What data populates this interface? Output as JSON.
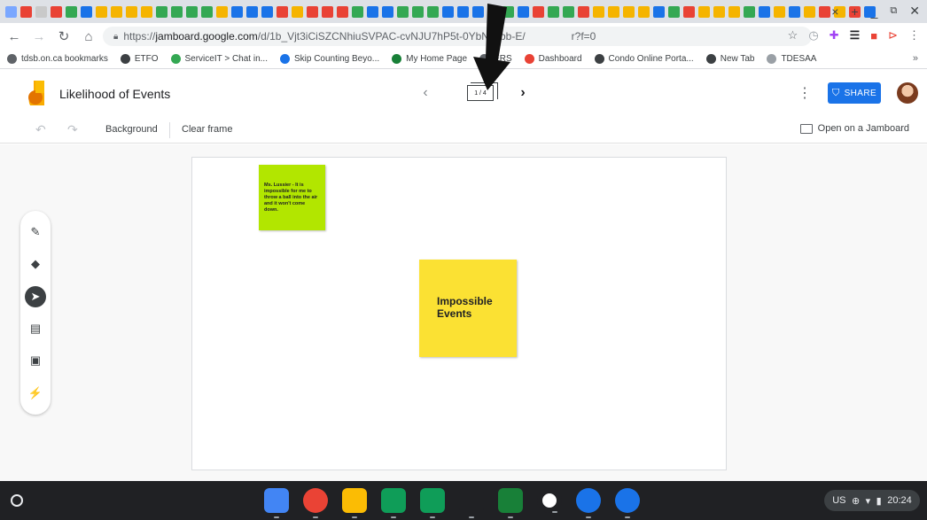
{
  "browser": {
    "url_prefix": "https://",
    "url_host": "jamboard.google.com",
    "url_path": "/d/1b_Vjt3iCiSZCNhiuSVPAC-cvNJU7hP5t-0YbNJvbb-E/",
    "url_tail": "r?f=0",
    "new_tab": "+",
    "tab_close": "×",
    "tab_favicon_colors": [
      "#7aa7ff",
      "#e94235",
      "#c9c9c9",
      "#e94235",
      "#34a853",
      "#1a73e8",
      "#f5b400",
      "#f5b400",
      "#f5b400",
      "#f5b400",
      "#34a853",
      "#34a853",
      "#34a853",
      "#34a853",
      "#f5b400",
      "#1a73e8",
      "#1a73e8",
      "#1a73e8",
      "#e94235",
      "#f5b400",
      "#e94235",
      "#e94235",
      "#e94235",
      "#34a853",
      "#1a73e8",
      "#1a73e8",
      "#34a853",
      "#34a853",
      "#34a853",
      "#1a73e8",
      "#1a73e8",
      "#1a73e8",
      "#1a73e8",
      "#34a853",
      "#1a73e8",
      "#e94235",
      "#34a853",
      "#34a853",
      "#e94235",
      "#f5b400",
      "#f5b400",
      "#f5b400",
      "#f5b400",
      "#1a73e8",
      "#34a853",
      "#e94235",
      "#f5b400",
      "#f5b400",
      "#f5b400",
      "#34a853",
      "#1a73e8",
      "#f5b400",
      "#1a73e8",
      "#f5b400",
      "#e94235",
      "#f5b400",
      "#e94235",
      "#1a73e8"
    ]
  },
  "bookmarks": [
    {
      "label": "tdsb.on.ca bookmarks",
      "color": "#5f6368"
    },
    {
      "label": "ETFO",
      "color": "#3c4043"
    },
    {
      "label": "ServiceIT > Chat in...",
      "color": "#34a853"
    },
    {
      "label": "Skip Counting Beyo...",
      "color": "#1a73e8"
    },
    {
      "label": "My Home Page",
      "color": "#188038"
    },
    {
      "label": "ERS",
      "color": "#5f6368"
    },
    {
      "label": "Dashboard",
      "color": "#e94235"
    },
    {
      "label": "Condo Online Porta...",
      "color": "#3c4043"
    },
    {
      "label": "New Tab",
      "color": "#3c4043"
    },
    {
      "label": "TDESAA",
      "color": "#9aa0a6"
    }
  ],
  "bookmarks_more": "»",
  "app": {
    "title": "Likelihood of Events",
    "frame_counter": "1 / 4",
    "share_label": "SHARE",
    "background_label": "Background",
    "clear_frame_label": "Clear frame",
    "open_jamboard_label": "Open on a Jamboard"
  },
  "stickies": {
    "green_text": "Ms. Lussier - It is impossible for me to throw a ball into the air and it won't come down.",
    "yellow_text": "Impossible Events"
  },
  "shelf": {
    "locale": "US",
    "time": "20:24",
    "app_colors": [
      "#4285f4",
      "#ea4335",
      "#fbbc04",
      "#0f9d58",
      "#0f9d58",
      "#202124",
      "#188038",
      "#ffffff",
      "#1a73e8",
      "#1a73e8"
    ]
  }
}
